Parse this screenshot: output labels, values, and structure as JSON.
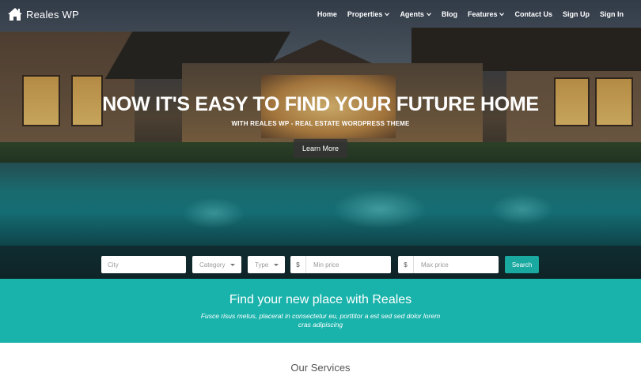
{
  "brand": {
    "name": "Reales WP",
    "icon": "house-icon"
  },
  "nav": {
    "items": [
      {
        "label": "Home",
        "dropdown": false
      },
      {
        "label": "Properties",
        "dropdown": true
      },
      {
        "label": "Agents",
        "dropdown": true
      },
      {
        "label": "Blog",
        "dropdown": false
      },
      {
        "label": "Features",
        "dropdown": true
      },
      {
        "label": "Contact Us",
        "dropdown": false
      },
      {
        "label": "Sign Up",
        "dropdown": false
      },
      {
        "label": "Sign In",
        "dropdown": false
      }
    ]
  },
  "hero": {
    "headline": "NOW IT'S EASY TO FIND YOUR FUTURE HOME",
    "subline": "WITH REALES WP - REAL ESTATE WORDPRESS THEME",
    "cta": "Learn More"
  },
  "search": {
    "city_placeholder": "City",
    "category_label": "Category",
    "type_label": "Type",
    "currency": "$",
    "min_price_placeholder": "Min price",
    "max_price_placeholder": "Max price",
    "button": "Search"
  },
  "band": {
    "title": "Find your new place with Reales",
    "text": "Fusce risus metus, placerat in consectetur eu, porttitor a est sed sed dolor lorem cras adipiscing"
  },
  "services": {
    "title": "Our Services"
  },
  "colors": {
    "accent": "#1ab3ab",
    "search_button": "#1aa9a0"
  }
}
